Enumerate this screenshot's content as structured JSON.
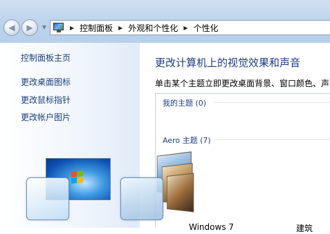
{
  "nav": {
    "back_glyph": "◀",
    "forward_glyph": "▶",
    "dropdown_glyph": "▼"
  },
  "address": {
    "icon": "control-panel-icon",
    "separator_glyph": "▶",
    "crumbs": [
      "控制面板",
      "外观和个性化",
      "个性化"
    ]
  },
  "sidebar": {
    "items": [
      {
        "label": "控制面板主页"
      },
      {
        "label": "更改桌面图标"
      },
      {
        "label": "更改鼠标指针"
      },
      {
        "label": "更改帐户图片"
      }
    ]
  },
  "main": {
    "title": "更改计算机上的视觉效果和声音",
    "description": "单击某个主题立即更改桌面背景、窗口颜色、声",
    "groups": [
      {
        "label": "我的主题 (0)"
      },
      {
        "label": "Aero 主题 (7)"
      }
    ],
    "themes": [
      {
        "name": "Windows 7"
      },
      {
        "name": "建筑"
      }
    ]
  }
}
